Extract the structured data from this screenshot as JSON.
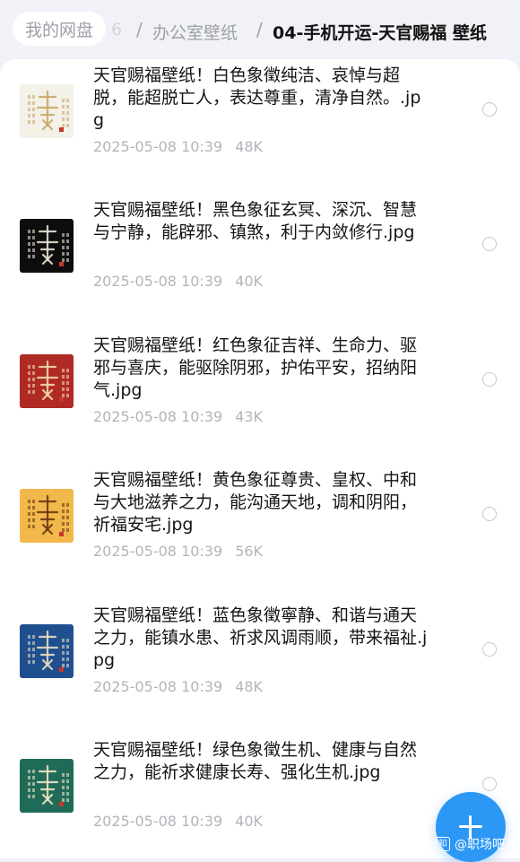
{
  "breadcrumb": {
    "root": "我的网盘",
    "partial": "6",
    "separator": "/",
    "middle": "办公室壁纸",
    "current": "04-手机开运-天官赐福 壁纸"
  },
  "files": [
    {
      "name": "天官赐福壁纸！白色象徵纯洁、哀悼与超脱，能超脱亡人，表达尊重，清净自然。.jpg",
      "date": "2025-05-08 10:39",
      "size": "48K",
      "thumb_bg": "#f3f1e8",
      "thumb_ink": "#c9a86b"
    },
    {
      "name": "天官赐福壁纸！黑色象征玄冥、深沉、智慧与宁静，能辟邪、镇煞，利于内敛修行.jpg",
      "date": "2025-05-08 10:39",
      "size": "40K",
      "thumb_bg": "#0d0d0d",
      "thumb_ink": "#e8e0cf"
    },
    {
      "name": "天官赐福壁纸！红色象征吉祥、生命力、驱邪与喜庆，能驱除阴邪，护佑平安，招纳阳气.jpg",
      "date": "2025-05-08 10:39",
      "size": "43K",
      "thumb_bg": "#b02a25",
      "thumb_ink": "#f0d9a6"
    },
    {
      "name": "天官赐福壁纸！黄色象征尊贵、皇权、中和与大地滋养之力，能沟通天地，调和阴阳，祈福安宅.jpg",
      "date": "2025-05-08 10:39",
      "size": "56K",
      "thumb_bg": "#f2b84b",
      "thumb_ink": "#6b3a12"
    },
    {
      "name": "天官赐福壁纸！蓝色象徵寧静、和谐与通天之力，能镇水患、祈求风调雨顺，带来福祉.jpg",
      "date": "2025-05-08 10:39",
      "size": "48K",
      "thumb_bg": "#1f4f8f",
      "thumb_ink": "#e8dcc0"
    },
    {
      "name": "天官赐福壁纸！绿色象徵生机、健康与自然之力，能祈求健康长寿、强化生机.jpg",
      "date": "2025-05-08 10:39",
      "size": "40K",
      "thumb_bg": "#1f6b58",
      "thumb_ink": "#efe3c5"
    }
  ],
  "fab": {
    "icon": "plus-icon",
    "color": "#2c97f5"
  },
  "watermark": {
    "icon": "zhihu-logo",
    "text": "@职场吧"
  }
}
